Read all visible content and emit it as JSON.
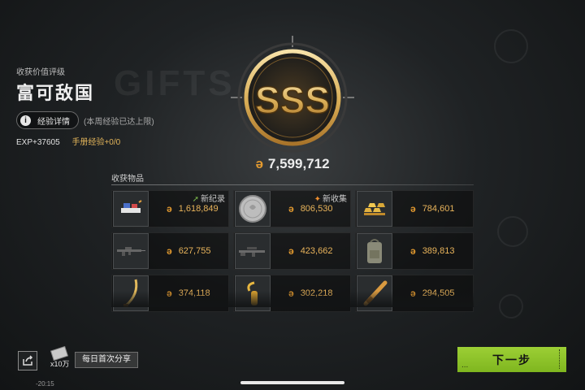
{
  "rating": {
    "caption": "收获价值评级",
    "title": "富可敌国",
    "badge_text": "SSS"
  },
  "exp": {
    "details_label": "经验详情",
    "info_glyph": "i",
    "weekly_cap_note": "(本周经验已达上限)",
    "exp_text": "EXP+37605",
    "manual_text": "手册经验+0/0"
  },
  "total_value": "7,599,712",
  "currency_icon": "koin-icon",
  "currency_glyph": "ǝ",
  "items_title": "收获物品",
  "items": [
    {
      "thumb": "tea-set-icon",
      "value": "1,618,849",
      "tag": "新纪录",
      "tag_type": "record"
    },
    {
      "thumb": "silver-coin-icon",
      "value": "806,530",
      "tag": "新收集",
      "tag_type": "collect"
    },
    {
      "thumb": "gold-bars-icon",
      "value": "784,601",
      "tag": "",
      "tag_type": ""
    },
    {
      "thumb": "assault-rifle-icon",
      "value": "627,755",
      "tag": "",
      "tag_type": ""
    },
    {
      "thumb": "rifle-icon",
      "value": "423,662",
      "tag": "",
      "tag_type": ""
    },
    {
      "thumb": "backpack-icon",
      "value": "389,813",
      "tag": "",
      "tag_type": ""
    },
    {
      "thumb": "saber-icon",
      "value": "374,118",
      "tag": "",
      "tag_type": ""
    },
    {
      "thumb": "golden-hook-icon",
      "value": "302,218",
      "tag": "",
      "tag_type": ""
    },
    {
      "thumb": "baton-icon",
      "value": "294,505",
      "tag": "",
      "tag_type": ""
    }
  ],
  "share": {
    "reward_qty": "x10万",
    "label": "每日首次分享"
  },
  "clock": "-20:15",
  "next_button": {
    "label": "下一步",
    "dots": "..."
  },
  "colors": {
    "accent_green": "#8dc42a",
    "gold": "#e59b2f",
    "record_star": "#ef8f2e",
    "collect_arrow": "#78b349"
  }
}
